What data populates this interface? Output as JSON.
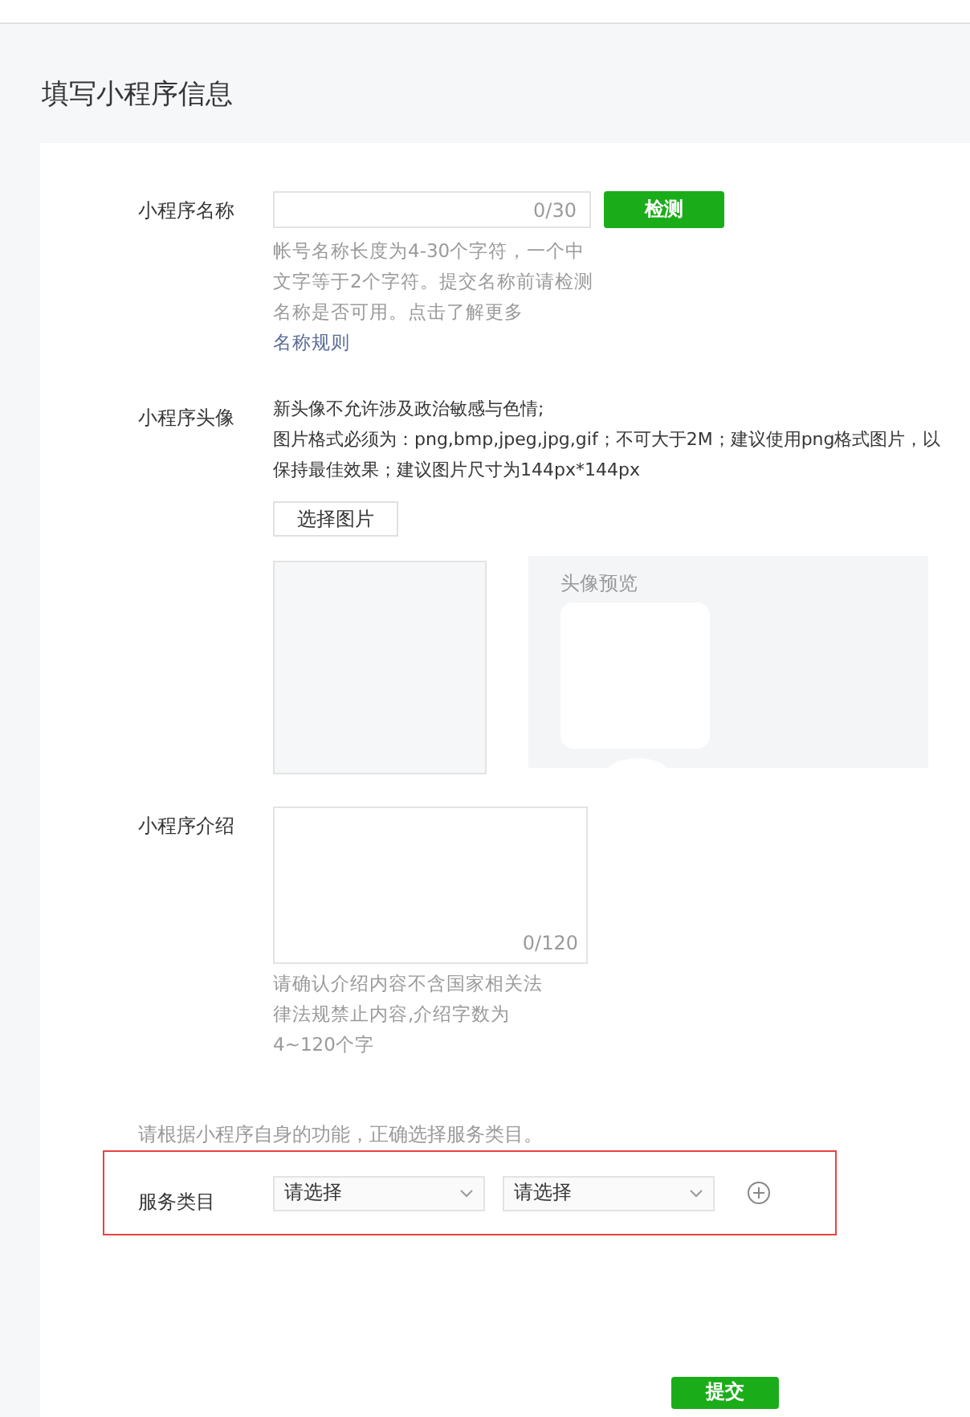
{
  "page_title": "填写小程序信息",
  "name_field": {
    "label": "小程序名称",
    "counter": "0/30",
    "check_button": "检测",
    "hint": "帐号名称长度为4-30个字符，一个中文字等于2个字符。提交名称前请检测名称是否可用。点击了解更多",
    "hint_link": "名称规则"
  },
  "avatar": {
    "label": "小程序头像",
    "notes": [
      "新头像不允许涉及政治敏感与色情;",
      "图片格式必须为：png,bmp,jpeg,jpg,gif；不可大于2M；建议使用png格式图片，以保持最佳效果；建议图片尺寸为144px*144px"
    ],
    "choose_button": "选择图片",
    "preview_label": "头像预览"
  },
  "intro_field": {
    "label": "小程序介绍",
    "counter": "0/120",
    "hint": "请确认介绍内容不含国家相关法律法规禁止内容,介绍字数为4~120个字"
  },
  "category": {
    "hint": "请根据小程序自身的功能，正确选择服务类目。",
    "label": "服务类目",
    "highlighted": true,
    "selects": [
      {
        "placeholder": "请选择"
      },
      {
        "placeholder": "请选择"
      }
    ]
  },
  "submit_button": "提交"
}
